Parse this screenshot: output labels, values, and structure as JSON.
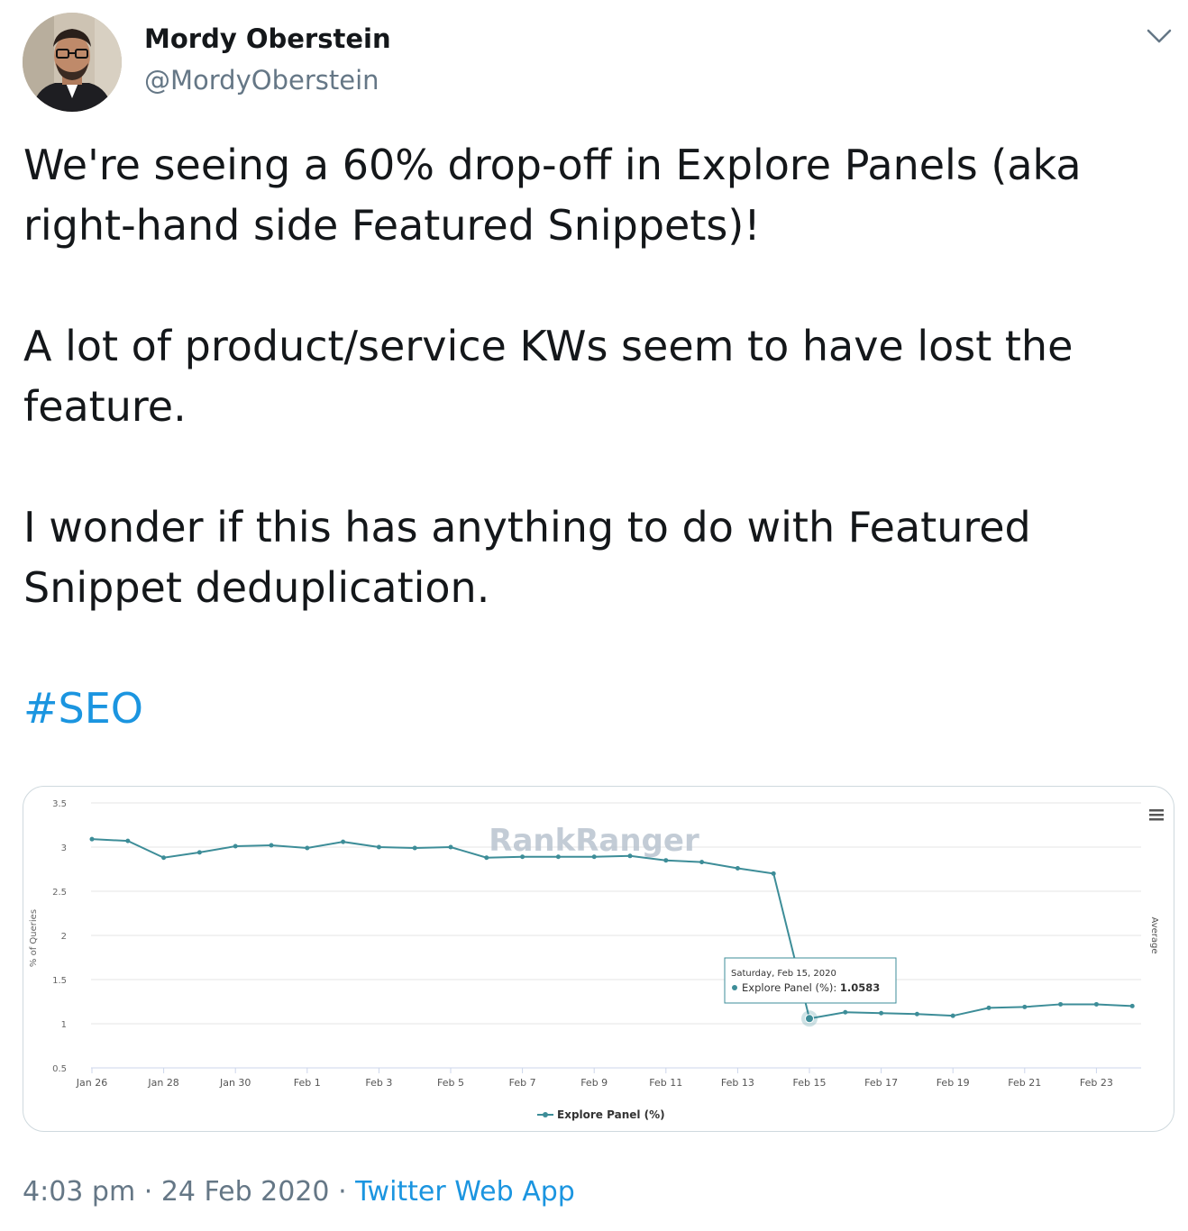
{
  "author": {
    "name": "Mordy Oberstein",
    "handle": "@MordyOberstein"
  },
  "tweet": {
    "paragraphs": [
      "We're seeing a 60% drop-off in Explore Panels (aka right-hand side Featured Snippets)!",
      "A lot of product/service KWs seem to have lost the feature.",
      "I wonder if this has anything to do with Featured Snippet deduplication."
    ],
    "hashtag": "#SEO"
  },
  "chart_data": {
    "type": "line",
    "watermark": "RankRanger",
    "ylabel": "% of Queries",
    "right_label": "Average",
    "ylim": [
      0.5,
      3.5
    ],
    "yticks": [
      0.5,
      1,
      1.5,
      2,
      2.5,
      3,
      3.5
    ],
    "x_tick_labels": [
      "Jan 26",
      "Jan 28",
      "Jan 30",
      "Feb 1",
      "Feb 3",
      "Feb 5",
      "Feb 7",
      "Feb 9",
      "Feb 11",
      "Feb 13",
      "Feb 15",
      "Feb 17",
      "Feb 19",
      "Feb 21",
      "Feb 23"
    ],
    "x": [
      "Jan 26",
      "Jan 27",
      "Jan 28",
      "Jan 29",
      "Jan 30",
      "Jan 31",
      "Feb 1",
      "Feb 2",
      "Feb 3",
      "Feb 4",
      "Feb 5",
      "Feb 6",
      "Feb 7",
      "Feb 8",
      "Feb 9",
      "Feb 10",
      "Feb 11",
      "Feb 12",
      "Feb 13",
      "Feb 14",
      "Feb 15",
      "Feb 16",
      "Feb 17",
      "Feb 18",
      "Feb 19",
      "Feb 20",
      "Feb 21",
      "Feb 22",
      "Feb 23",
      "Feb 24"
    ],
    "series": [
      {
        "name": "Explore Panel (%)",
        "color": "#3d8d98",
        "values": [
          3.09,
          3.07,
          2.88,
          2.94,
          3.01,
          3.02,
          2.99,
          3.06,
          3.0,
          2.99,
          3.0,
          2.88,
          2.89,
          2.89,
          2.89,
          2.9,
          2.85,
          2.83,
          2.76,
          2.7,
          1.0583,
          1.13,
          1.12,
          1.11,
          1.09,
          1.18,
          1.19,
          1.22,
          1.22,
          1.2
        ]
      }
    ],
    "legend": "bottom-center",
    "grid": true,
    "tooltip": {
      "date": "Saturday, Feb 15, 2020",
      "label": "Explore Panel (%):",
      "value": "1.0583",
      "index": 20
    },
    "menu_icon": "hamburger-menu-icon"
  },
  "footer": {
    "time": "4:03 pm",
    "sep1": "·",
    "date": "24 Feb 2020",
    "sep2": "·",
    "source": "Twitter Web App"
  }
}
